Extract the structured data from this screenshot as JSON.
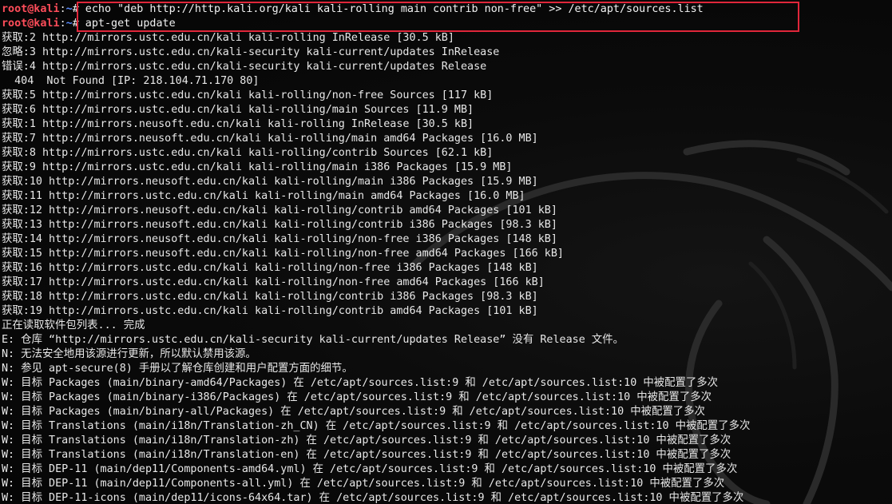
{
  "terminal": {
    "prompt": {
      "user": "root@kali",
      "separator": ":",
      "path": "~"
    },
    "commands": [
      "# echo \"deb http://http.kali.org/kali kali-rolling main contrib non-free\" >> /etc/apt/sources.list",
      "# apt-get update"
    ],
    "output": [
      "获取:2 http://mirrors.ustc.edu.cn/kali kali-rolling InRelease [30.5 kB]",
      "忽略:3 http://mirrors.ustc.edu.cn/kali-security kali-current/updates InRelease",
      "错误:4 http://mirrors.ustc.edu.cn/kali-security kali-current/updates Release",
      "  404  Not Found [IP: 218.104.71.170 80]",
      "获取:5 http://mirrors.ustc.edu.cn/kali kali-rolling/non-free Sources [117 kB]",
      "获取:6 http://mirrors.ustc.edu.cn/kali kali-rolling/main Sources [11.9 MB]",
      "获取:1 http://mirrors.neusoft.edu.cn/kali kali-rolling InRelease [30.5 kB]",
      "获取:7 http://mirrors.neusoft.edu.cn/kali kali-rolling/main amd64 Packages [16.0 MB]",
      "获取:8 http://mirrors.ustc.edu.cn/kali kali-rolling/contrib Sources [62.1 kB]",
      "获取:9 http://mirrors.ustc.edu.cn/kali kali-rolling/main i386 Packages [15.9 MB]",
      "获取:10 http://mirrors.neusoft.edu.cn/kali kali-rolling/main i386 Packages [15.9 MB]",
      "获取:11 http://mirrors.ustc.edu.cn/kali kali-rolling/main amd64 Packages [16.0 MB]",
      "获取:12 http://mirrors.neusoft.edu.cn/kali kali-rolling/contrib amd64 Packages [101 kB]",
      "获取:13 http://mirrors.neusoft.edu.cn/kali kali-rolling/contrib i386 Packages [98.3 kB]",
      "获取:14 http://mirrors.neusoft.edu.cn/kali kali-rolling/non-free i386 Packages [148 kB]",
      "获取:15 http://mirrors.neusoft.edu.cn/kali kali-rolling/non-free amd64 Packages [166 kB]",
      "获取:16 http://mirrors.ustc.edu.cn/kali kali-rolling/non-free i386 Packages [148 kB]",
      "获取:17 http://mirrors.ustc.edu.cn/kali kali-rolling/non-free amd64 Packages [166 kB]",
      "获取:18 http://mirrors.ustc.edu.cn/kali kali-rolling/contrib i386 Packages [98.3 kB]",
      "获取:19 http://mirrors.ustc.edu.cn/kali kali-rolling/contrib amd64 Packages [101 kB]",
      "正在读取软件包列表... 完成",
      "E: 仓库 “http://mirrors.ustc.edu.cn/kali-security kali-current/updates Release” 没有 Release 文件。",
      "N: 无法安全地用该源进行更新，所以默认禁用该源。",
      "N: 参见 apt-secure(8) 手册以了解仓库创建和用户配置方面的细节。",
      "W: 目标 Packages (main/binary-amd64/Packages) 在 /etc/apt/sources.list:9 和 /etc/apt/sources.list:10 中被配置了多次",
      "W: 目标 Packages (main/binary-i386/Packages) 在 /etc/apt/sources.list:9 和 /etc/apt/sources.list:10 中被配置了多次",
      "W: 目标 Packages (main/binary-all/Packages) 在 /etc/apt/sources.list:9 和 /etc/apt/sources.list:10 中被配置了多次",
      "W: 目标 Translations (main/i18n/Translation-zh_CN) 在 /etc/apt/sources.list:9 和 /etc/apt/sources.list:10 中被配置了多次",
      "W: 目标 Translations (main/i18n/Translation-zh) 在 /etc/apt/sources.list:9 和 /etc/apt/sources.list:10 中被配置了多次",
      "W: 目标 Translations (main/i18n/Translation-en) 在 /etc/apt/sources.list:9 和 /etc/apt/sources.list:10 中被配置了多次",
      "W: 目标 DEP-11 (main/dep11/Components-amd64.yml) 在 /etc/apt/sources.list:9 和 /etc/apt/sources.list:10 中被配置了多次",
      "W: 目标 DEP-11 (main/dep11/Components-all.yml) 在 /etc/apt/sources.list:9 和 /etc/apt/sources.list:10 中被配置了多次",
      "W: 目标 DEP-11-icons (main/dep11/icons-64x64.tar) 在 /etc/apt/sources.list:9 和 /etc/apt/sources.list:10 中被配置了多次"
    ]
  },
  "colors": {
    "background": "#0a0a0a",
    "text": "#e8e8e8",
    "prompt_user": "#ff4d5a",
    "prompt_path": "#5a8cff",
    "highlight_border": "#e0263a"
  },
  "decoration": {
    "wallpaper_icon": "kali-dragon-icon"
  }
}
